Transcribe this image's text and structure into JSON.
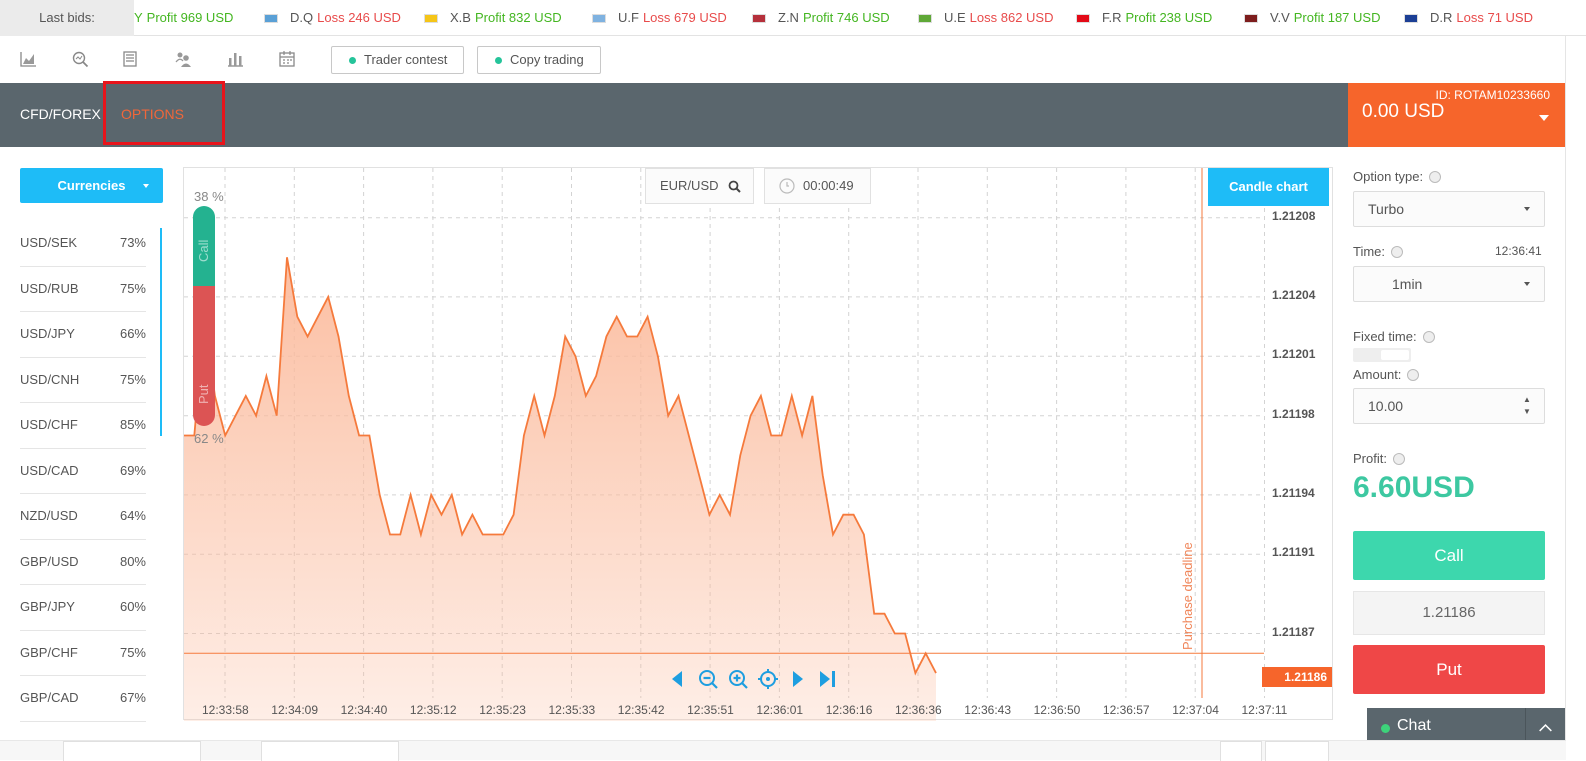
{
  "ticker": {
    "label": "Last bids:",
    "items": [
      {
        "symbol": "",
        "result": "Profit 969 USD",
        "kind": "profit",
        "flag_color": "#ffffff"
      },
      {
        "symbol": "D.Q",
        "result": "Loss 246 USD",
        "kind": "loss",
        "flag_color": "#5aa0d6"
      },
      {
        "symbol": "X.B",
        "result": "Profit 832 USD",
        "kind": "profit",
        "flag_color": "#f5c518"
      },
      {
        "symbol": "U.F",
        "result": "Loss 679 USD",
        "kind": "loss",
        "flag_color": "#7fb2e0"
      },
      {
        "symbol": "Z.N",
        "result": "Profit 746 USD",
        "kind": "profit",
        "flag_color": "#b5303b"
      },
      {
        "symbol": "U.E",
        "result": "Loss 862 USD",
        "kind": "loss",
        "flag_color": "#5fa837"
      },
      {
        "symbol": "F.R",
        "result": "Profit 238 USD",
        "kind": "profit",
        "flag_color": "#e30a17"
      },
      {
        "symbol": "V.V",
        "result": "Profit 187 USD",
        "kind": "profit",
        "flag_color": "#7d1d1d"
      },
      {
        "symbol": "D.R",
        "result": "Loss 71 USD",
        "kind": "loss",
        "flag_color": "#1c3f95"
      }
    ]
  },
  "toolbar": {
    "icons": [
      "chart-area-icon",
      "search-chart-icon",
      "document-icon",
      "users-icon",
      "bar-chart-icon",
      "calendar-icon"
    ],
    "trader_contest": "Trader contest",
    "copy_trading": "Copy trading"
  },
  "nav": {
    "cfd_forex": "CFD/FOREX",
    "options": "OPTIONS"
  },
  "balance": {
    "id": "ID: ROTAM10233660",
    "amount": "0.00 USD"
  },
  "left": {
    "currencies_label": "Currencies",
    "pairs": [
      {
        "name": "USD/SEK",
        "pct": "73%"
      },
      {
        "name": "USD/RUB",
        "pct": "75%"
      },
      {
        "name": "USD/JPY",
        "pct": "66%"
      },
      {
        "name": "USD/CNH",
        "pct": "75%"
      },
      {
        "name": "USD/CHF",
        "pct": "85%"
      },
      {
        "name": "USD/CAD",
        "pct": "69%"
      },
      {
        "name": "NZD/USD",
        "pct": "64%"
      },
      {
        "name": "GBP/USD",
        "pct": "80%"
      },
      {
        "name": "GBP/JPY",
        "pct": "60%"
      },
      {
        "name": "GBP/CHF",
        "pct": "75%"
      },
      {
        "name": "GBP/CAD",
        "pct": "67%"
      }
    ]
  },
  "chart": {
    "symbol": "EUR/USD",
    "timer": "00:00:49",
    "candle_chart": "Candle chart",
    "call_pct": "38 %",
    "put_pct": "62 %",
    "call_label": "Call",
    "put_label": "Put",
    "current_price": "1.21186",
    "purchase_deadline": "Purchase deadline",
    "colors": {
      "line": "#f57a3c",
      "fill": "#fbbb9d",
      "grid": "#d3d3d3"
    }
  },
  "chart_data": {
    "type": "area",
    "series": [
      {
        "values": [
          1.21197,
          1.21197,
          1.21203,
          1.21199,
          1.21197,
          1.21198,
          1.21199,
          1.21198,
          1.212,
          1.21198,
          1.21206,
          1.21203,
          1.21202,
          1.21203,
          1.21204,
          1.21202,
          1.21199,
          1.21197,
          1.21197,
          1.21194,
          1.21192,
          1.21192,
          1.21194,
          1.21192,
          1.21194,
          1.21193,
          1.21194,
          1.21192,
          1.21193,
          1.21192,
          1.21192,
          1.21192,
          1.21193,
          1.21197,
          1.21199,
          1.21197,
          1.21199,
          1.21202,
          1.21201,
          1.21199,
          1.212,
          1.21202,
          1.21203,
          1.21202,
          1.21202,
          1.21203,
          1.21201,
          1.21198,
          1.21199,
          1.21197,
          1.21195,
          1.21193,
          1.21194,
          1.21193,
          1.21196,
          1.21198,
          1.21199,
          1.21197,
          1.21197,
          1.21199,
          1.21197,
          1.21199,
          1.21195,
          1.21192,
          1.21193,
          1.21193,
          1.21192,
          1.21188,
          1.21188,
          1.21187,
          1.21187,
          1.21185,
          1.21186,
          1.21185
        ]
      }
    ],
    "y_ticks": [
      "1.21208",
      "1.21204",
      "1.21201",
      "1.21198",
      "1.21194",
      "1.21191",
      "1.21187"
    ],
    "x_ticks": [
      "12:33:58",
      "12:34:09",
      "12:34:40",
      "12:35:12",
      "12:35:23",
      "12:35:33",
      "12:35:42",
      "12:35:51",
      "12:36:01",
      "12:36:16",
      "12:36:36",
      "12:36:43",
      "12:36:50",
      "12:36:57",
      "12:37:04",
      "12:37:11"
    ],
    "ylim": [
      1.211845,
      1.212095
    ],
    "current_value": 1.21186,
    "grid": true
  },
  "right": {
    "option_type_label": "Option type:",
    "option_type_value": "Turbo",
    "time_label": "Time:",
    "time_value": "12:36:41",
    "time_select": "1min",
    "fixed_time_label": "Fixed time:",
    "amount_label": "Amount:",
    "amount_value": "10.00",
    "profit_label": "Profit:",
    "profit_value": "6.60USD",
    "call_label": "Call",
    "price": "1.21186",
    "put_label": "Put"
  },
  "chat": {
    "label": "Chat"
  }
}
